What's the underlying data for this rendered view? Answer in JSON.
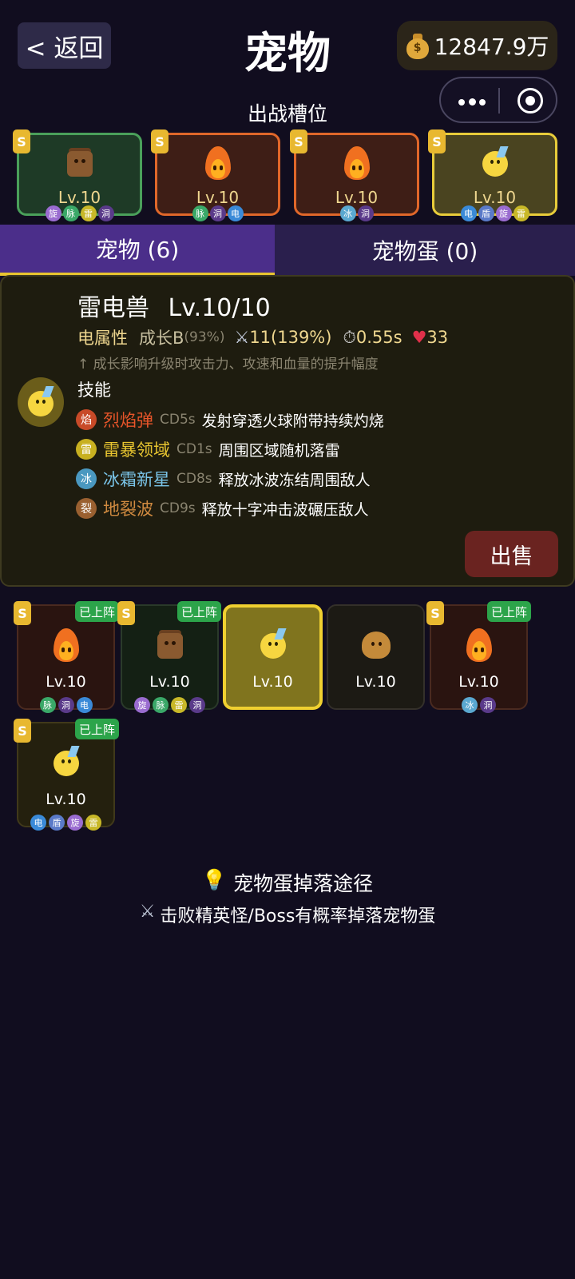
{
  "header": {
    "back_label": "< 返回",
    "title": "宠物",
    "coins": "12847.9万",
    "coin_icon": "money-bag-icon"
  },
  "slots": {
    "title": "出战槽位",
    "items": [
      {
        "rank": "S",
        "level": "Lv.10",
        "pet": "stump",
        "tags": [
          "旋",
          "脉",
          "雷",
          "洞"
        ]
      },
      {
        "rank": "S",
        "level": "Lv.10",
        "pet": "fire",
        "tags": [
          "脉",
          "洞",
          "电"
        ]
      },
      {
        "rank": "S",
        "level": "Lv.10",
        "pet": "fire",
        "tags": [
          "冰",
          "洞"
        ]
      },
      {
        "rank": "S",
        "level": "Lv.10",
        "pet": "thunder-bird",
        "tags": [
          "电",
          "盾",
          "旋",
          "雷"
        ]
      }
    ]
  },
  "tabs": {
    "pets": "宠物 (6)",
    "eggs": "宠物蛋 (0)"
  },
  "detail": {
    "name": "雷电兽",
    "level": "Lv.10/10",
    "element": "电属性",
    "growth_label": "成长B",
    "growth_pct": "(93%)",
    "attack": "11(139%)",
    "speed": "0.55s",
    "hp": "33",
    "hint": "↑ 成长影响升级时攻击力、攻速和血量的提升幅度",
    "skills_label": "技能",
    "skills": [
      {
        "icon": "焰",
        "name": "烈焰弹",
        "cd": "CD5s",
        "desc": "发射穿透火球附带持续灼烧",
        "color": "#e8552a"
      },
      {
        "icon": "雷",
        "name": "雷暴领域",
        "cd": "CD1s",
        "desc": "周围区域随机落雷",
        "color": "#e8c530"
      },
      {
        "icon": "冰",
        "name": "冰霜新星",
        "cd": "CD8s",
        "desc": "释放冰波冻结周围敌人",
        "color": "#7ac4e8"
      },
      {
        "icon": "裂",
        "name": "地裂波",
        "cd": "CD9s",
        "desc": "释放十字冲击波碾压敌人",
        "color": "#d08a40"
      }
    ],
    "sell_label": "出售"
  },
  "inventory": {
    "deployed_label": "已上阵",
    "items": [
      {
        "rank": "S",
        "level": "Lv.10",
        "pet": "fire",
        "deployed": true,
        "tags": [
          "脉",
          "洞",
          "电"
        ]
      },
      {
        "rank": "S",
        "level": "Lv.10",
        "pet": "stump",
        "deployed": true,
        "tags": [
          "旋",
          "脉",
          "雷",
          "洞"
        ]
      },
      {
        "rank": "",
        "level": "Lv.10",
        "pet": "thunder-bird",
        "deployed": false,
        "selected": true,
        "tags": []
      },
      {
        "rank": "",
        "level": "Lv.10",
        "pet": "rock",
        "deployed": false,
        "tags": []
      },
      {
        "rank": "S",
        "level": "Lv.10",
        "pet": "fire",
        "deployed": true,
        "tags": [
          "冰",
          "洞"
        ]
      },
      {
        "rank": "S",
        "level": "Lv.10",
        "pet": "thunder-bird",
        "deployed": true,
        "tags": [
          "电",
          "盾",
          "旋",
          "雷"
        ]
      }
    ]
  },
  "drops": {
    "title": "宠物蛋掉落途径",
    "title_icon": "lightbulb-icon",
    "desc": "击败精英怪/Boss有概率掉落宠物蛋",
    "desc_icon": "crossed-swords-icon"
  },
  "colors": {
    "tag_旋": "#9a6cd0",
    "tag_脉": "#3aa868",
    "tag_雷": "#c8b828",
    "tag_洞": "#5a3a8a",
    "tag_电": "#3a8ad8",
    "tag_冰": "#5aa8d0",
    "tag_盾": "#5a7ac8"
  }
}
